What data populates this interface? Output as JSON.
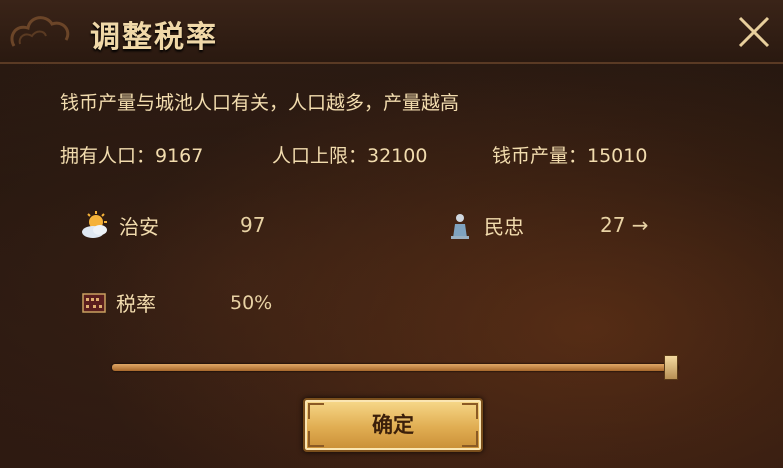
{
  "dialog": {
    "title": "调整税率",
    "description": "钱币产量与城池人口有关，人口越多，产量越高"
  },
  "stats": {
    "population": "拥有人口：9167",
    "population_cap": "人口上限：32100",
    "coin_output": "钱币产量：15010"
  },
  "order": {
    "label": "治安",
    "value": "97",
    "icon": "sun-cloud-icon"
  },
  "loyalty": {
    "label": "民忠",
    "value": "27 →",
    "icon": "figure-icon"
  },
  "tax": {
    "label": "税率",
    "value": "50%",
    "icon": "abacus-icon",
    "slider_fraction": 1.0
  },
  "buttons": {
    "confirm": "确定"
  },
  "colors": {
    "text": "#f2dcae",
    "accent": "#e0ad52",
    "title": "#f0d8a8"
  }
}
